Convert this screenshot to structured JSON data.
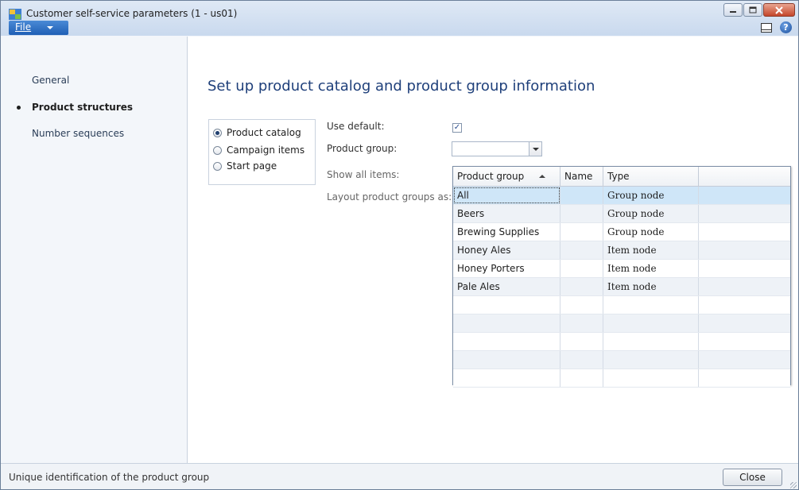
{
  "window": {
    "title": "Customer self-service parameters (1 - us01)",
    "file_menu_label": "File"
  },
  "sidebar": {
    "items": [
      {
        "label": "General",
        "active": false
      },
      {
        "label": "Product structures",
        "active": true
      },
      {
        "label": "Number sequences",
        "active": false
      }
    ]
  },
  "main": {
    "title": "Set up product catalog and product group information",
    "radio_options": [
      {
        "label": "Product catalog",
        "selected": true
      },
      {
        "label": "Campaign items",
        "selected": false
      },
      {
        "label": "Start page",
        "selected": false
      }
    ],
    "fields": {
      "use_default_label": "Use default:",
      "use_default_checked": true,
      "product_group_label": "Product group:",
      "product_group_value": "",
      "show_all_items_label": "Show all items:",
      "layout_label": "Layout product groups as:"
    }
  },
  "lookup": {
    "columns": [
      "Product group",
      "Name",
      "Type"
    ],
    "sort_column": "Product group",
    "rows": [
      {
        "group": "All",
        "name": "",
        "type": "Group node",
        "selected": true
      },
      {
        "group": "Beers",
        "name": "",
        "type": "Group node",
        "selected": false
      },
      {
        "group": "Brewing Supplies",
        "name": "",
        "type": "Group node",
        "selected": false
      },
      {
        "group": "Honey Ales",
        "name": "",
        "type": "Item node",
        "selected": false
      },
      {
        "group": "Honey Porters",
        "name": "",
        "type": "Item node",
        "selected": false
      },
      {
        "group": "Pale Ales",
        "name": "",
        "type": "Item node",
        "selected": false
      }
    ]
  },
  "statusbar": {
    "help_text": "Unique identification of the product group",
    "close_label": "Close"
  },
  "colors": {
    "title_blue": "#1e3f7a",
    "file_button": "#1f5fb5",
    "selected_row": "#cfe6f8"
  }
}
